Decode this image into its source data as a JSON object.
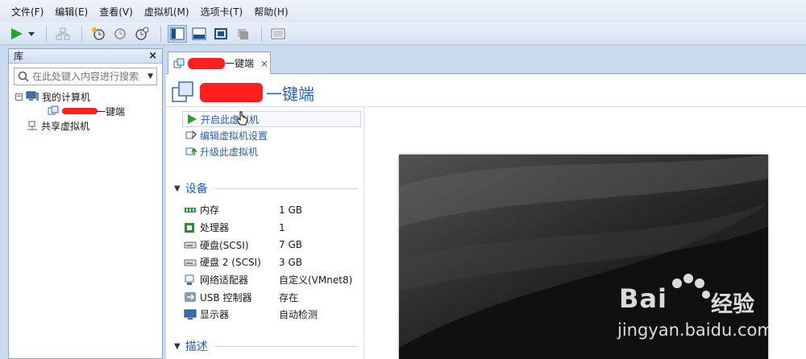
{
  "menu": [
    "文件(F)",
    "编辑(E)",
    "查看(V)",
    "虚拟机(M)",
    "选项卡(T)",
    "帮助(H)"
  ],
  "library": {
    "title": "库",
    "close": "×",
    "search_placeholder": "在此处键入内容进行搜索",
    "tree": {
      "root": "我的计算机",
      "child": "一键端",
      "shared": "共享虚拟机"
    }
  },
  "tab": {
    "label": "一键端",
    "close": "×"
  },
  "vm": {
    "title": "一键端",
    "actions": [
      "开启此虚拟机",
      "编辑虚拟机设置",
      "升级此虚拟机"
    ]
  },
  "devices": {
    "header": "设备",
    "rows": [
      {
        "name": "内存",
        "value": "1 GB",
        "icon": "memory-icon"
      },
      {
        "name": "处理器",
        "value": "1",
        "icon": "cpu-icon"
      },
      {
        "name": "硬盘(SCSI)",
        "value": "7 GB",
        "icon": "hdd-icon"
      },
      {
        "name": "硬盘 2 (SCSI)",
        "value": "3 GB",
        "icon": "hdd-icon"
      },
      {
        "name": "网络适配器",
        "value": "自定义(VMnet8)",
        "icon": "network-icon"
      },
      {
        "name": "USB 控制器",
        "value": "存在",
        "icon": "usb-icon"
      },
      {
        "name": "显示器",
        "value": "自动检测",
        "icon": "display-icon"
      }
    ]
  },
  "description": {
    "header": "描述"
  },
  "watermark": {
    "brand": "Bai",
    "brand2": "经验",
    "url": "jingyan.baidu.com"
  },
  "colors": {
    "accent": "#2a5fa8",
    "redact": "#ff1f1f",
    "frame": "#c9d9ee"
  }
}
